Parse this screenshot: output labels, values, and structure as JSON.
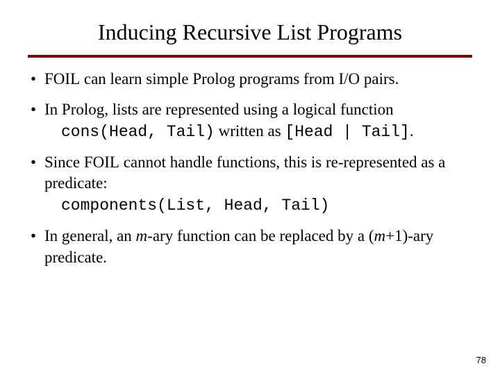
{
  "title": "Inducing Recursive List Programs",
  "bullets": {
    "b1_pre": "F",
    "b1_sc": "OIL",
    "b1_post": " can learn simple Prolog programs from I/O pairs.",
    "b2_a": "In Prolog, lists are represented using a logical function ",
    "b2_code1": "cons(Head, Tail)",
    "b2_mid": " written as ",
    "b2_code2": "[Head | Tail]",
    "b2_end": ".",
    "b3_a": "Since F",
    "b3_sc": "OIL",
    "b3_b": " cannot handle functions, this is re-represented as a predicate:",
    "b3_code": "components(List, Head, Tail)",
    "b4_a": "In general, an ",
    "b4_m": "m",
    "b4_b": "-ary function can be replaced by a (",
    "b4_m2": "m",
    "b4_c": "+1)-ary predicate."
  },
  "page": "78"
}
